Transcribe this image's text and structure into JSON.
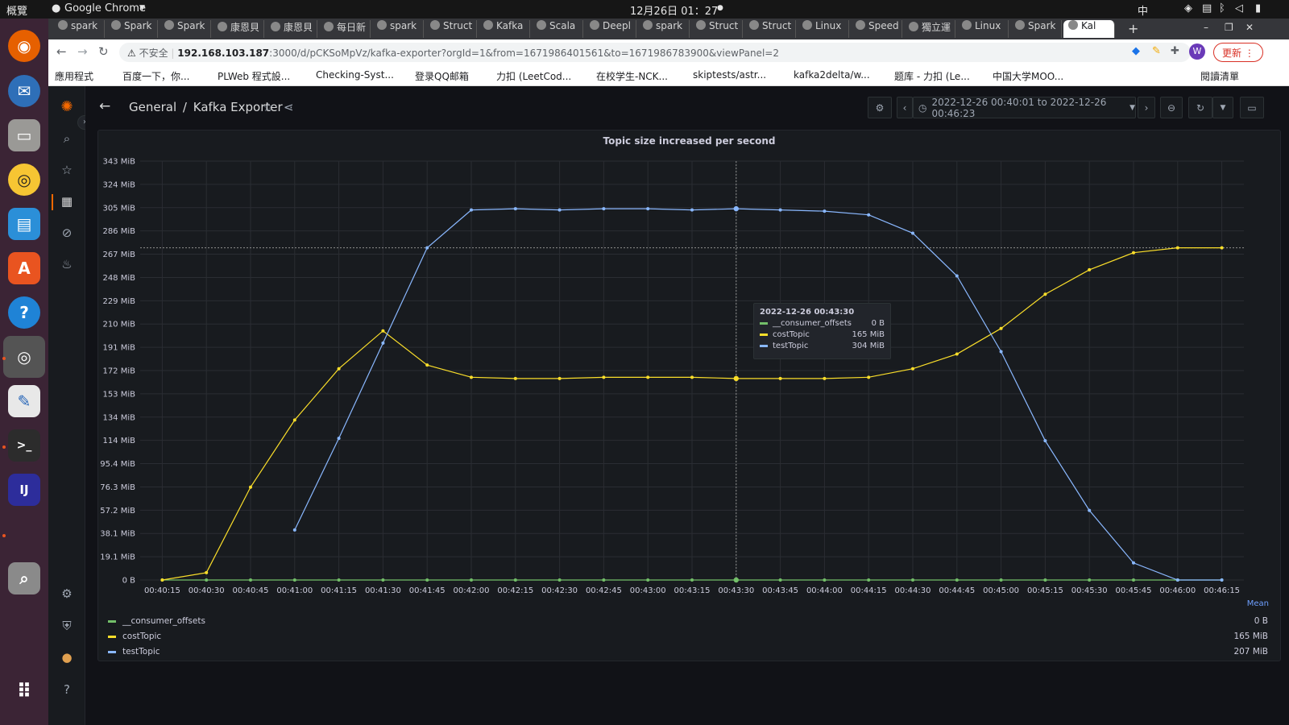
{
  "os": {
    "activities": "概覽",
    "app_name": "Google Chrome",
    "clock": "12月26日 01：27",
    "input_method": "中"
  },
  "browser": {
    "tabs": [
      "spark",
      "Spark",
      "Spark",
      "康恩貝",
      "康恩貝",
      "每日新",
      "spark",
      "Struct",
      "Kafka",
      "Scala",
      "Deepl",
      "spark",
      "Struct",
      "Struct",
      "Linux",
      "Speed",
      "獨立運",
      "Linux",
      "Spark",
      "Kal"
    ],
    "security_label": "不安全",
    "url_host": "192.168.103.187",
    "url_path": ":3000/d/pCKSoMpVz/kafka-exporter?orgId=1&from=1671986401561&to=1671986783900&viewPanel=2",
    "update_button": "更新",
    "bookmarks": [
      "應用程式",
      "百度一下，你...",
      "PLWeb 程式設...",
      "Checking-Syst...",
      "登录QQ邮箱",
      "力扣 (LeetCod...",
      "在校学生-NCK...",
      "skiptests/astr...",
      "kafka2delta/w...",
      "题库 - 力扣 (Le...",
      "中国大学MOO...",
      "閱讀清單"
    ]
  },
  "grafana": {
    "breadcrumb_folder": "General",
    "breadcrumb_sep": "/",
    "dashboard_title": "Kafka Exporter",
    "time_range": "2022-12-26 00:40:01 to 2022-12-26 00:46:23",
    "panel_title": "Topic size increased per second",
    "tooltip": {
      "time": "2022-12-26 00:43:30",
      "rows": [
        {
          "name": "__consumer_offsets",
          "value": "0 B"
        },
        {
          "name": "costTopic",
          "value": "165 MiB"
        },
        {
          "name": "testTopic",
          "value": "304 MiB"
        }
      ]
    },
    "legend_header": "Mean",
    "legend": [
      {
        "name": "__consumer_offsets",
        "value": "0 B"
      },
      {
        "name": "costTopic",
        "value": "165 MiB"
      },
      {
        "name": "testTopic",
        "value": "207 MiB"
      }
    ]
  },
  "colors": {
    "consumer_offsets": "#73bf69",
    "costTopic": "#fade2a",
    "testTopic": "#8ab8ff",
    "grid": "#2a2d33",
    "background": "#181b1f"
  },
  "chart_data": {
    "type": "line",
    "title": "Topic size increased per second",
    "y_unit": "MiB",
    "ylim": [
      0,
      343
    ],
    "y_ticks": [
      "0 B",
      "19.1 MiB",
      "38.1 MiB",
      "57.2 MiB",
      "76.3 MiB",
      "95.4 MiB",
      "114 MiB",
      "134 MiB",
      "153 MiB",
      "172 MiB",
      "191 MiB",
      "210 MiB",
      "229 MiB",
      "248 MiB",
      "267 MiB",
      "286 MiB",
      "305 MiB",
      "324 MiB",
      "343 MiB"
    ],
    "x_ticks": [
      "00:40:15",
      "00:40:30",
      "00:40:45",
      "00:41:00",
      "00:41:15",
      "00:41:30",
      "00:41:45",
      "00:42:00",
      "00:42:15",
      "00:42:30",
      "00:42:45",
      "00:43:00",
      "00:43:15",
      "00:43:30",
      "00:43:45",
      "00:44:00",
      "00:44:15",
      "00:44:30",
      "00:44:45",
      "00:45:00",
      "00:45:15",
      "00:45:30",
      "00:45:45",
      "00:46:00",
      "00:46:15"
    ],
    "series": [
      {
        "name": "__consumer_offsets",
        "x": [
          "00:40:15",
          "00:40:30",
          "00:40:45",
          "00:41:00",
          "00:41:15",
          "00:41:30",
          "00:41:45",
          "00:42:00",
          "00:42:15",
          "00:42:30",
          "00:42:45",
          "00:43:00",
          "00:43:15",
          "00:43:30",
          "00:43:45",
          "00:44:00",
          "00:44:15",
          "00:44:30",
          "00:44:45",
          "00:45:00",
          "00:45:15",
          "00:45:30",
          "00:45:45",
          "00:46:00",
          "00:46:15"
        ],
        "values": [
          0,
          0,
          0,
          0,
          0,
          0,
          0,
          0,
          0,
          0,
          0,
          0,
          0,
          0,
          0,
          0,
          0,
          0,
          0,
          0,
          0,
          0,
          0,
          0,
          0
        ]
      },
      {
        "name": "costTopic",
        "x": [
          "00:40:15",
          "00:40:30",
          "00:40:45",
          "00:41:00",
          "00:41:15",
          "00:41:30",
          "00:41:45",
          "00:42:00",
          "00:42:15",
          "00:42:30",
          "00:42:45",
          "00:43:00",
          "00:43:15",
          "00:43:30",
          "00:43:45",
          "00:44:00",
          "00:44:15",
          "00:44:30",
          "00:44:45",
          "00:45:00",
          "00:45:15",
          "00:45:30",
          "00:45:45",
          "00:46:00",
          "00:46:15"
        ],
        "values": [
          0,
          6,
          76,
          131,
          173,
          204,
          176,
          166,
          165,
          165,
          166,
          166,
          166,
          165,
          165,
          165,
          166,
          173,
          185,
          206,
          234,
          254,
          268,
          272,
          272
        ]
      },
      {
        "name": "testTopic",
        "x": [
          "00:41:00",
          "00:41:15",
          "00:41:30",
          "00:41:45",
          "00:42:00",
          "00:42:15",
          "00:42:30",
          "00:42:45",
          "00:43:00",
          "00:43:15",
          "00:43:30",
          "00:43:45",
          "00:44:00",
          "00:44:15",
          "00:44:30",
          "00:44:45",
          "00:45:00",
          "00:45:15",
          "00:45:30",
          "00:45:45",
          "00:46:00",
          "00:46:15"
        ],
        "values": [
          41,
          116,
          194,
          272,
          303,
          304,
          303,
          304,
          304,
          303,
          304,
          303,
          302,
          299,
          284,
          249,
          187,
          114,
          57,
          14,
          0,
          0
        ]
      }
    ],
    "grid": true,
    "legend_position": "bottom"
  }
}
